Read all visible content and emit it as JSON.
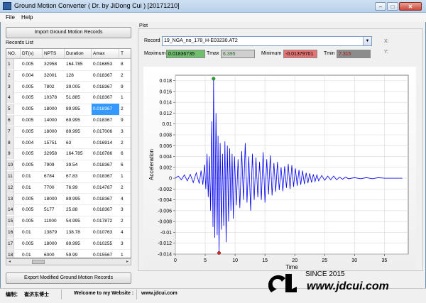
{
  "window": {
    "title": "Ground Motion Converter ( Dr. by JiDong Cui ) [20171210]"
  },
  "menu": [
    "File",
    "Help"
  ],
  "left": {
    "import_button": "Import Ground Motion Records",
    "records_list_label": "Records List",
    "export_button": "Export Modified Ground Motion Records",
    "columns": [
      "NO.",
      "DT(s)",
      "NPTS",
      "Duration",
      "Amax",
      "T"
    ],
    "rows": [
      [
        "1",
        "0.005",
        "32958",
        "164.785",
        "0.016853",
        "8"
      ],
      [
        "2",
        "0.004",
        "32001",
        "128",
        "0.018367",
        "2"
      ],
      [
        "3",
        "0.005",
        "7802",
        "39.005",
        "0.018367",
        "9"
      ],
      [
        "4",
        "0.005",
        "10378",
        "51.885",
        "0.018367",
        "1"
      ],
      [
        "5",
        "0.005",
        "18000",
        "89.995",
        "0.018367",
        "2"
      ],
      [
        "6",
        "0.005",
        "14000",
        "69.995",
        "0.018367",
        "9"
      ],
      [
        "7",
        "0.005",
        "18000",
        "89.995",
        "0.017006",
        "3"
      ],
      [
        "8",
        "0.004",
        "15751",
        "63",
        "0.016914",
        "2"
      ],
      [
        "9",
        "0.005",
        "32958",
        "164.785",
        "0.016786",
        "6"
      ],
      [
        "10",
        "0.005",
        "7909",
        "39.54",
        "0.018367",
        "6"
      ],
      [
        "11",
        "0.01",
        "6784",
        "67.83",
        "0.018367",
        "1"
      ],
      [
        "12",
        "0.01",
        "7700",
        "76.99",
        "0.014787",
        "2"
      ],
      [
        "13",
        "0.005",
        "18000",
        "89.995",
        "0.018367",
        "4"
      ],
      [
        "14",
        "0.005",
        "5177",
        "25.88",
        "0.018367",
        "3"
      ],
      [
        "15",
        "0.005",
        "11000",
        "54.995",
        "0.017872",
        "2"
      ],
      [
        "16",
        "0.01",
        "13879",
        "138.78",
        "0.010763",
        "4"
      ],
      [
        "17",
        "0.005",
        "18000",
        "89.995",
        "0.010255",
        "3"
      ],
      [
        "18",
        "0.01",
        "6000",
        "59.99",
        "0.015567",
        "1"
      ]
    ],
    "selected_row": 4
  },
  "plot": {
    "group_label": "Plot",
    "record_label": "Record",
    "record_value": "19_NGA_no_178_H-E03230.AT2",
    "x_label": "X:",
    "y_label": "Y:",
    "maximum_label": "Maximum",
    "maximum_value": "0.01836735",
    "tmax_label": "Tmax",
    "tmax_value": "6.395",
    "minimum_label": "Minimum",
    "minimum_value": "-0.01379701",
    "tmin_label": "Tmin",
    "tmin_value": "7.315",
    "colors": {
      "max_field": "#6fbf6f",
      "min_field": "#e57373",
      "line": "#0000ee",
      "grid": "#d9d9d9"
    }
  },
  "chart_data": {
    "type": "line",
    "xlabel": "Time",
    "ylabel": "Acceleration",
    "xlim": [
      0,
      39
    ],
    "ylim": [
      -0.014,
      0.019
    ],
    "xticks": [
      0,
      5,
      10,
      15,
      20,
      25,
      30,
      35
    ],
    "yticks": [
      -0.014,
      -0.012,
      -0.01,
      -0.008,
      -0.006,
      -0.004,
      -0.002,
      0,
      0.002,
      0.004,
      0.006,
      0.008,
      0.01,
      0.012,
      0.014,
      0.016,
      0.018
    ],
    "ytick_labels": [
      "-0.014",
      "-0.012",
      "-0.01",
      "-0.008",
      "-0.006",
      "-0.004",
      "-0.002",
      "0",
      "0.002",
      "0.004",
      "0.006",
      "0.008",
      "0.01",
      "0.012",
      "0.014",
      "0.016",
      "0.018"
    ],
    "grid": true,
    "series": [
      {
        "x": [
          0,
          0.5,
          1,
          1.5,
          2,
          2.5,
          3,
          3.5,
          4,
          4.3,
          4.6,
          4.9,
          5.1,
          5.3,
          5.5,
          5.7,
          5.9,
          6.1,
          6.3,
          6.395,
          6.6,
          6.8,
          7.0,
          7.15,
          7.315,
          7.5,
          7.7,
          7.9,
          8.1,
          8.3,
          8.5,
          8.7,
          8.9,
          9.1,
          9.3,
          9.5,
          9.7,
          9.9,
          10.2,
          10.5,
          10.8,
          11.1,
          11.4,
          11.7,
          12.0,
          12.3,
          12.6,
          12.9,
          13.2,
          13.5,
          13.8,
          14.1,
          14.4,
          14.7,
          15.0,
          15.3,
          15.6,
          15.9,
          16.2,
          16.5,
          16.8,
          17.1,
          17.4,
          17.7,
          18.0,
          18.3,
          18.6,
          18.9,
          19.2,
          19.5,
          19.8,
          20.1,
          20.4,
          20.7,
          21.0,
          21.3,
          21.6,
          21.9,
          22.2,
          22.5,
          22.8,
          23.1,
          23.4,
          23.7,
          24.0,
          24.5,
          25.0,
          25.5,
          26.0,
          26.5,
          27.0,
          27.5,
          28.0,
          28.5,
          29.0,
          30.0,
          31.0,
          32.0,
          33.0,
          34.0,
          35.0,
          36.0,
          37.0,
          38.0
        ],
        "y": [
          0,
          0.0004,
          -0.0003,
          0.0006,
          -0.0005,
          0.0007,
          -0.0008,
          0.001,
          -0.001,
          0.0014,
          -0.0012,
          0.0025,
          -0.002,
          0.0045,
          -0.0035,
          0.004,
          -0.006,
          0.0105,
          -0.009,
          0.01836735,
          -0.011,
          0.012,
          -0.0105,
          0.0078,
          -0.01379701,
          0.0065,
          -0.0095,
          0.0045,
          -0.0088,
          0.0068,
          -0.0118,
          0.006,
          -0.008,
          0.0055,
          -0.006,
          0.0045,
          -0.0075,
          0.004,
          -0.005,
          0.0035,
          -0.0055,
          0.005,
          -0.004,
          0.0065,
          -0.0045,
          0.004,
          -0.006,
          0.0045,
          -0.004,
          0.0038,
          -0.0035,
          0.003,
          -0.004,
          0.0048,
          -0.0045,
          0.0035,
          -0.003,
          0.0042,
          -0.0032,
          0.0028,
          -0.0025,
          0.003,
          -0.0022,
          0.002,
          -0.0024,
          0.0022,
          -0.0018,
          0.0026,
          -0.002,
          0.0024,
          -0.0016,
          0.0018,
          -0.0014,
          0.0015,
          -0.0012,
          0.0014,
          -0.0011,
          0.001,
          -0.0009,
          0.0009,
          -0.0008,
          0.0007,
          -0.0006,
          0.0006,
          -0.0005,
          0.0005,
          -0.0004,
          0.0004,
          -0.0003,
          0.0004,
          -0.0003,
          0.0002,
          -0.0002,
          0.0002,
          -0.0001,
          0.0001,
          -0.0001,
          0.0001,
          -0.0001,
          0.0001,
          0,
          0,
          0,
          0
        ]
      }
    ],
    "markers": [
      {
        "x": 6.395,
        "y": 0.01836735,
        "color": "#22aa22"
      },
      {
        "x": 7.315,
        "y": -0.01379701,
        "color": "#dd2222"
      }
    ]
  },
  "footer": {
    "editor_label": "编制：",
    "editor_name": "崔济东博士",
    "welcome": "Welcome to my Website :",
    "website": "www.jdcui.com",
    "logo_since": "SINCE 2015",
    "logo_url": "www.jdcui.com"
  }
}
